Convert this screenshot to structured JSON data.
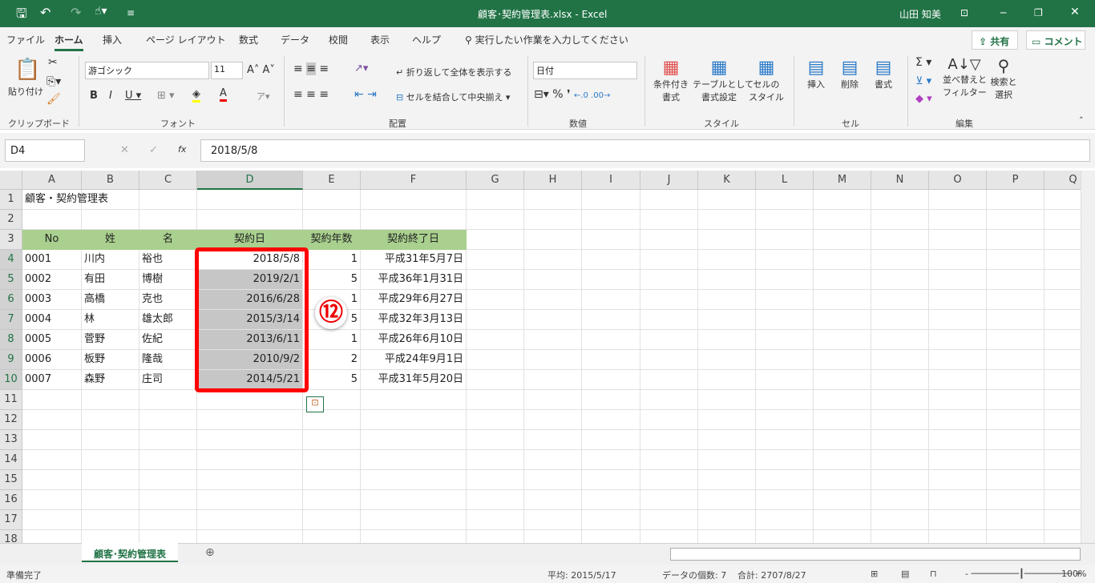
{
  "title": {
    "filename": "顧客･契約管理表.xlsx  -  Excel",
    "user": "山田 知美"
  },
  "menu": {
    "items": [
      "ファイル",
      "ホーム",
      "挿入",
      "ページ レイアウト",
      "数式",
      "データ",
      "校閲",
      "表示",
      "ヘルプ"
    ],
    "active": "ホーム",
    "search_placeholder": "実行したい作業を入力してください",
    "share": "共有",
    "comment": "コメント"
  },
  "ribbon": {
    "paste": "貼り付け",
    "font_name": "游ゴシック",
    "font_size": "11",
    "wrap": "折り返して全体を表示する",
    "merge": "セルを結合して中央揃え",
    "number_format": "日付",
    "cond_format": [
      "条件付き",
      "書式"
    ],
    "table_format": [
      "テーブルとして",
      "書式設定"
    ],
    "cell_style": [
      "セルの",
      "スタイル"
    ],
    "insert": "挿入",
    "delete": "削除",
    "format": "書式",
    "sort": [
      "並べ替えと",
      "フィルター"
    ],
    "find": [
      "検索と",
      "選択"
    ],
    "groups": [
      "クリップボード",
      "フォント",
      "配置",
      "数値",
      "スタイル",
      "セル",
      "編集"
    ]
  },
  "formula_bar": {
    "name_box": "D4",
    "formula": "2018/5/8"
  },
  "columns": [
    "A",
    "B",
    "C",
    "D",
    "E",
    "F",
    "G",
    "H",
    "I",
    "J",
    "K",
    "L",
    "M",
    "N",
    "O",
    "P",
    "Q"
  ],
  "sheet": {
    "title": "顧客・契約管理表",
    "headers": [
      "No",
      "姓",
      "名",
      "契約日",
      "契約年数",
      "契約終了日"
    ],
    "rows": [
      [
        "0001",
        "川内",
        "裕也",
        "2018/5/8",
        "1",
        "平成31年5月7日"
      ],
      [
        "0002",
        "有田",
        "博樹",
        "2019/2/1",
        "5",
        "平成36年1月31日"
      ],
      [
        "0003",
        "高橋",
        "克也",
        "2016/6/28",
        "1",
        "平成29年6月27日"
      ],
      [
        "0004",
        "林",
        "雄太郎",
        "2015/3/14",
        "5",
        "平成32年3月13日"
      ],
      [
        "0005",
        "菅野",
        "佐紀",
        "2013/6/11",
        "1",
        "平成26年6月10日"
      ],
      [
        "0006",
        "板野",
        "隆哉",
        "2010/9/2",
        "2",
        "平成24年9月1日"
      ],
      [
        "0007",
        "森野",
        "庄司",
        "2014/5/21",
        "5",
        "平成31年5月20日"
      ]
    ]
  },
  "annotation": "⑫",
  "colors": {
    "excel_green": "#217346",
    "header_fill": "#a9d08e",
    "selection": "#c6c6c6",
    "highlight": "#ff0000"
  },
  "tabs": {
    "sheet": "顧客･契約管理表"
  },
  "status": {
    "ready": "準備完了",
    "average": "平均: 2015/5/17",
    "count": "データの個数: 7",
    "sum": "合計: 2707/8/27",
    "zoom": "100%"
  }
}
